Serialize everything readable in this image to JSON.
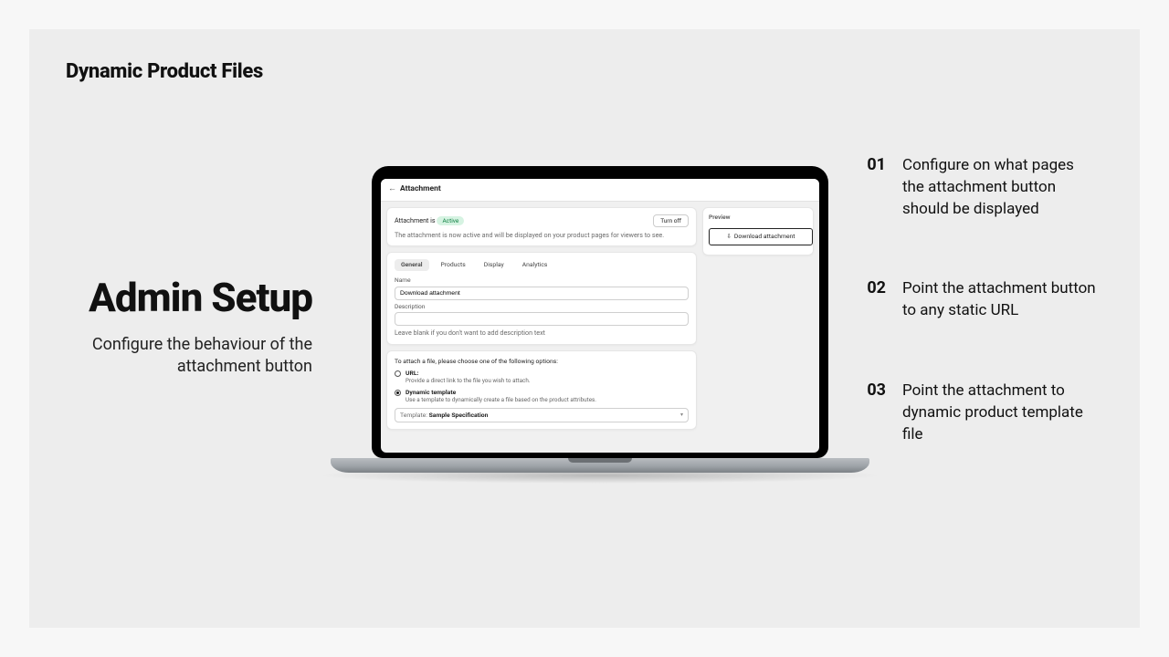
{
  "brand": "Dynamic Product Files",
  "headline": {
    "title": "Admin Setup",
    "subtitle": "Configure the behaviour of the attachment button"
  },
  "steps": [
    {
      "num": "01",
      "text": "Configure on what pages the attachment button should be displayed"
    },
    {
      "num": "02",
      "text": "Point the attachment button to any static URL"
    },
    {
      "num": "03",
      "text": "Point the attachment to dynamic product template file"
    }
  ],
  "admin": {
    "page_title": "Attachment",
    "status_card": {
      "prefix": "Attachment is",
      "badge": "Active",
      "turn_off": "Turn off",
      "helper": "The attachment is now active and will be displayed on your product pages for viewers to see."
    },
    "tabs": {
      "general": "General",
      "products": "Products",
      "display": "Display",
      "analytics": "Analytics"
    },
    "name_label": "Name",
    "name_value": "Download attachment",
    "desc_label": "Description",
    "desc_value": "",
    "desc_helper": "Leave blank if you don't want to add description text",
    "attach_prompt": "To attach a file, please choose one of the following options:",
    "option_url": {
      "title": "URL:",
      "desc": "Provide a direct link to the file you wish to attach."
    },
    "option_dyn": {
      "title": "Dynamic template",
      "desc": "Use a template to dynamically create a file based on the product attributes."
    },
    "template_label": "Template:",
    "template_value": "Sample Specification",
    "preview_title": "Preview",
    "preview_btn": "Download attachment"
  }
}
